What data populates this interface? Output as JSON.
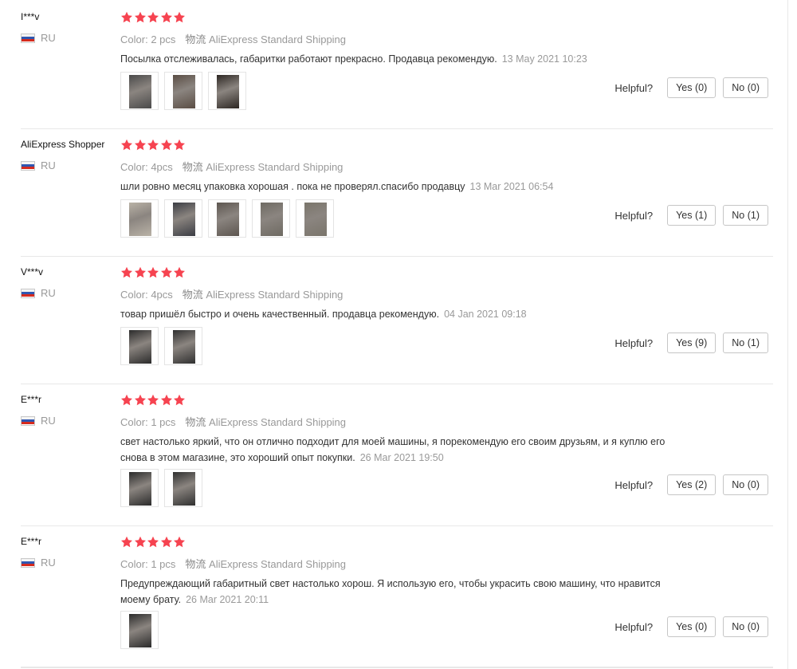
{
  "helpful_label": "Helpful?",
  "sku_label": "Color:",
  "logistics_label": "物流",
  "logistics_value": "AliExpress Standard Shipping",
  "rating_icon": "star-icon",
  "colors": {
    "star": "#f64350",
    "muted": "#999999",
    "divider": "#e8e8e8"
  },
  "reviews": [
    {
      "user": "I***v",
      "country": "RU",
      "rating": 5,
      "color": "2 pcs",
      "text": "Посылка отслеживалась, габаритки работают прекрасно. Продавца рекомендую.",
      "date": "13 May 2021 10:23",
      "photos": 3,
      "yes": "Yes (0)",
      "no": "No (0)"
    },
    {
      "user": "AliExpress Shopper",
      "country": "RU",
      "rating": 5,
      "color": "4pcs",
      "text": "шли ровно месяц упаковка хорошая . пока не проверял.спасибо продавцу",
      "date": "13 Mar 2021 06:54",
      "photos": 5,
      "yes": "Yes (1)",
      "no": "No (1)"
    },
    {
      "user": "V***v",
      "country": "RU",
      "rating": 5,
      "color": "4pcs",
      "text": "товар пришёл быстро и очень качественный. продавца рекомендую.",
      "date": "04 Jan 2021 09:18",
      "photos": 2,
      "yes": "Yes (9)",
      "no": "No (1)"
    },
    {
      "user": "E***r",
      "country": "RU",
      "rating": 5,
      "color": "1 pcs",
      "text": "свет настолько яркий, что он отлично подходит для моей машины, я порекомендую его своим друзьям, и я куплю его снова в этом магазине, это хороший опыт покупки.",
      "date": "26 Mar 2021 19:50",
      "photos": 2,
      "yes": "Yes (2)",
      "no": "No (0)"
    },
    {
      "user": "E***r",
      "country": "RU",
      "rating": 5,
      "color": "1 pcs",
      "text": "Предупреждающий габаритный свет настолько хорош. Я использую его, чтобы украсить свою машину, что нравится моему брату.",
      "date": "26 Mar 2021 20:11",
      "photos": 1,
      "yes": "Yes (0)",
      "no": "No (0)"
    }
  ]
}
